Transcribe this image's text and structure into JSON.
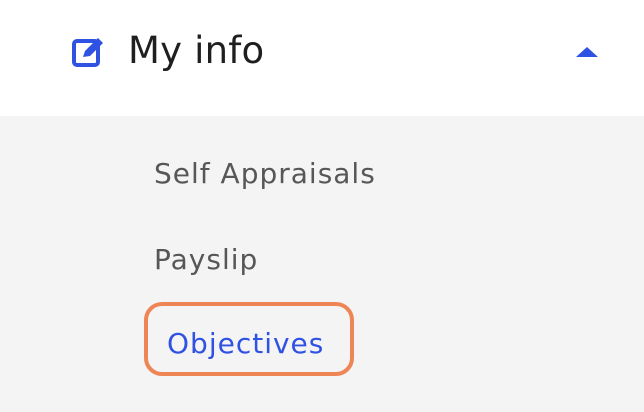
{
  "header": {
    "title": "My info",
    "icon": "edit-icon",
    "toggle_icon": "caret-up-icon",
    "accent_color": "#2f52e3"
  },
  "submenu": {
    "items": [
      {
        "label": "Self Appraisals",
        "active": false
      },
      {
        "label": "Payslip",
        "active": false
      },
      {
        "label": "Objectives",
        "active": true
      }
    ],
    "active_color": "#2f52e3",
    "highlight_color": "#ee8555"
  }
}
